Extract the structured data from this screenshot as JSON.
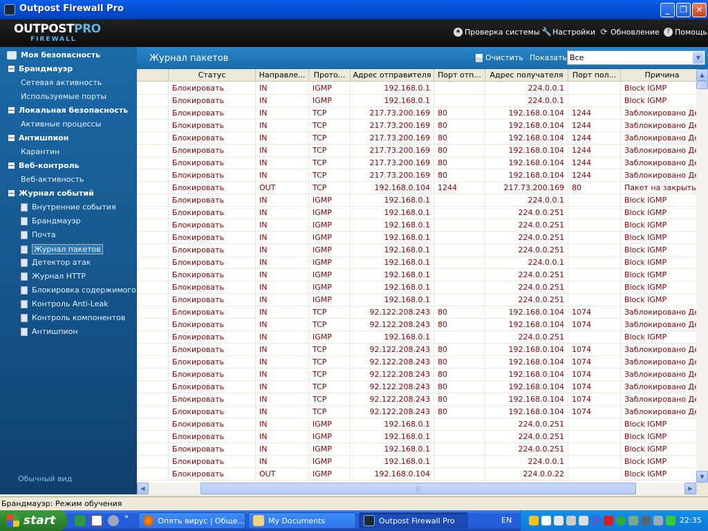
{
  "window": {
    "title": "Outpost Firewall Pro"
  },
  "logo": {
    "line1a": "OUTPOST",
    "line1b": "PRO",
    "line2": "FIREWALL"
  },
  "header_menu": [
    {
      "label": "Проверка системы",
      "icon": "system-check-icon"
    },
    {
      "label": "Настройки",
      "icon": "wrench-icon"
    },
    {
      "label": "Обновление",
      "icon": "refresh-icon"
    },
    {
      "label": "Помощь",
      "icon": "help-icon"
    }
  ],
  "sidebar": {
    "sections": [
      {
        "label": "Моя безопасность",
        "items": []
      },
      {
        "label": "Брандмауэр",
        "items": [
          "Сетевая активность",
          "Используемые порты"
        ]
      },
      {
        "label": "Локальная безопасность",
        "items": [
          "Активные процессы"
        ]
      },
      {
        "label": "Антишпион",
        "items": [
          "Карантин"
        ]
      },
      {
        "label": "Веб-контроль",
        "items": [
          "Веб-активность"
        ]
      },
      {
        "label": "Журнал событий",
        "items": [
          "Внутренние события",
          "Брандмауэр",
          "Почта",
          "Журнал пакетов",
          "Детектор атак",
          "Журнал HTTP",
          "Блокировка содержимого",
          "Контроль Anti-Leak",
          "Контроль компонентов",
          "Антишпион"
        ]
      }
    ],
    "normal_view": "Обычный вид"
  },
  "content": {
    "title": "Журнал пакетов",
    "clear_label": "Очистить",
    "show_label": "Показать:",
    "show_value": "Все"
  },
  "table": {
    "columns": [
      "",
      "Статус",
      "Направле...",
      "Прото...",
      "Адрес отправителя",
      "Порт отп...",
      "Адрес получателя",
      "Порт пол...",
      "Причина"
    ],
    "rows": [
      [
        "Блокировать",
        "IN",
        "IGMP",
        "192.168.0.1",
        "",
        "224.0.0.1",
        "",
        "Block IGMP"
      ],
      [
        "Блокировать",
        "IN",
        "IGMP",
        "192.168.0.1",
        "",
        "224.0.0.1",
        "",
        "Block IGMP"
      ],
      [
        "Блокировать",
        "IN",
        "TCP",
        "217.73.200.169",
        "80",
        "192.168.0.104",
        "1244",
        "Заблокировано Детектором атак"
      ],
      [
        "Блокировать",
        "IN",
        "TCP",
        "217.73.200.169",
        "80",
        "192.168.0.104",
        "1244",
        "Заблокировано Детектором атак"
      ],
      [
        "Блокировать",
        "IN",
        "TCP",
        "217.73.200.169",
        "80",
        "192.168.0.104",
        "1244",
        "Заблокировано Детектором атак"
      ],
      [
        "Блокировать",
        "IN",
        "TCP",
        "217.73.200.169",
        "80",
        "192.168.0.104",
        "1244",
        "Заблокировано Детектором атак"
      ],
      [
        "Блокировать",
        "IN",
        "TCP",
        "217.73.200.169",
        "80",
        "192.168.0.104",
        "1244",
        "Заблокировано Детектором атак"
      ],
      [
        "Блокировать",
        "IN",
        "TCP",
        "217.73.200.169",
        "80",
        "192.168.0.104",
        "1244",
        "Заблокировано Детектором атак"
      ],
      [
        "Блокировать",
        "OUT",
        "TCP",
        "192.168.0.104",
        "1244",
        "217.73.200.169",
        "80",
        "Пакет на закрытый порт"
      ],
      [
        "Блокировать",
        "IN",
        "IGMP",
        "192.168.0.1",
        "",
        "224.0.0.1",
        "",
        "Block IGMP"
      ],
      [
        "Блокировать",
        "IN",
        "IGMP",
        "192.168.0.1",
        "",
        "224.0.0.251",
        "",
        "Block IGMP"
      ],
      [
        "Блокировать",
        "IN",
        "IGMP",
        "192.168.0.1",
        "",
        "224.0.0.251",
        "",
        "Block IGMP"
      ],
      [
        "Блокировать",
        "IN",
        "IGMP",
        "192.168.0.1",
        "",
        "224.0.0.251",
        "",
        "Block IGMP"
      ],
      [
        "Блокировать",
        "IN",
        "IGMP",
        "192.168.0.1",
        "",
        "224.0.0.251",
        "",
        "Block IGMP"
      ],
      [
        "Блокировать",
        "IN",
        "IGMP",
        "192.168.0.1",
        "",
        "224.0.0.1",
        "",
        "Block IGMP"
      ],
      [
        "Блокировать",
        "IN",
        "IGMP",
        "192.168.0.1",
        "",
        "224.0.0.251",
        "",
        "Block IGMP"
      ],
      [
        "Блокировать",
        "IN",
        "IGMP",
        "192.168.0.1",
        "",
        "224.0.0.251",
        "",
        "Block IGMP"
      ],
      [
        "Блокировать",
        "IN",
        "IGMP",
        "192.168.0.1",
        "",
        "224.0.0.251",
        "",
        "Block IGMP"
      ],
      [
        "Блокировать",
        "IN",
        "TCP",
        "92.122.208.243",
        "80",
        "192.168.0.104",
        "1074",
        "Заблокировано Детектором атак"
      ],
      [
        "Блокировать",
        "IN",
        "TCP",
        "92.122.208.243",
        "80",
        "192.168.0.104",
        "1074",
        "Заблокировано Детектором атак"
      ],
      [
        "Блокировать",
        "IN",
        "IGMP",
        "192.168.0.1",
        "",
        "224.0.0.251",
        "",
        "Block IGMP"
      ],
      [
        "Блокировать",
        "IN",
        "TCP",
        "92.122.208.243",
        "80",
        "192.168.0.104",
        "1074",
        "Заблокировано Детектором атак"
      ],
      [
        "Блокировать",
        "IN",
        "TCP",
        "92.122.208.243",
        "80",
        "192.168.0.104",
        "1074",
        "Заблокировано Детектором атак"
      ],
      [
        "Блокировать",
        "IN",
        "TCP",
        "92.122.208.243",
        "80",
        "192.168.0.104",
        "1074",
        "Заблокировано Детектором атак"
      ],
      [
        "Блокировать",
        "IN",
        "TCP",
        "92.122.208.243",
        "80",
        "192.168.0.104",
        "1074",
        "Заблокировано Детектором атак"
      ],
      [
        "Блокировать",
        "IN",
        "TCP",
        "92.122.208.243",
        "80",
        "192.168.0.104",
        "1074",
        "Заблокировано Детектором атак"
      ],
      [
        "Блокировать",
        "IN",
        "TCP",
        "92.122.208.243",
        "80",
        "192.168.0.104",
        "1074",
        "Заблокировано Детектором атак"
      ],
      [
        "Блокировать",
        "IN",
        "IGMP",
        "192.168.0.1",
        "",
        "224.0.0.251",
        "",
        "Block IGMP"
      ],
      [
        "Блокировать",
        "IN",
        "IGMP",
        "192.168.0.1",
        "",
        "224.0.0.251",
        "",
        "Block IGMP"
      ],
      [
        "Блокировать",
        "IN",
        "IGMP",
        "192.168.0.1",
        "",
        "224.0.0.251",
        "",
        "Block IGMP"
      ],
      [
        "Блокировать",
        "IN",
        "IGMP",
        "192.168.0.1",
        "",
        "224.0.0.1",
        "",
        "Block IGMP"
      ],
      [
        "Блокировать",
        "OUT",
        "IGMP",
        "192.168.0.104",
        "",
        "224.0.0.22",
        "",
        "Block IGMP"
      ]
    ]
  },
  "statusbar": {
    "text": "Брандмауэр: Режим обучения"
  },
  "taskbar": {
    "start": "start",
    "tasks": [
      {
        "label": "Опять вирус | Обще...",
        "icon": "firefox-icon"
      },
      {
        "label": "My Documents",
        "icon": "folder-icon"
      },
      {
        "label": "Outpost Firewall Pro",
        "icon": "outpost-icon"
      }
    ],
    "lang": "EN",
    "clock": "22:35"
  },
  "colors": {
    "accent": "#1a6aa8",
    "row_text": "#8b0000",
    "titlebar": "#0550D6"
  }
}
